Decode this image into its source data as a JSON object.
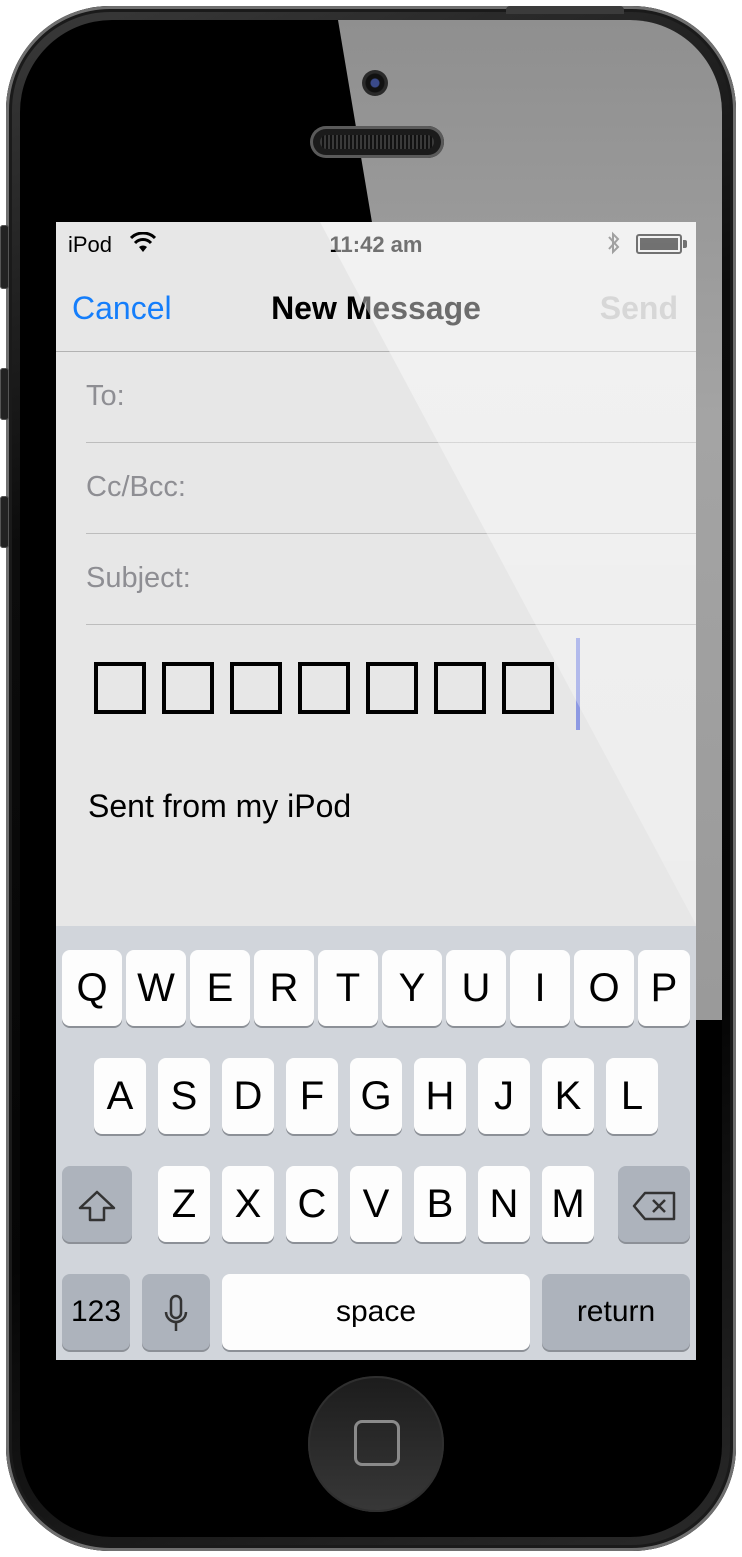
{
  "status_bar": {
    "carrier": "iPod",
    "time": "11:42 am"
  },
  "nav": {
    "cancel": "Cancel",
    "title": "New Message",
    "send": "Send"
  },
  "fields": {
    "to": "To:",
    "cc": "Cc/Bcc:",
    "subject": "Subject:"
  },
  "body": {
    "signature": "Sent from my iPod"
  },
  "keyboard": {
    "row1": [
      "Q",
      "W",
      "E",
      "R",
      "T",
      "Y",
      "U",
      "I",
      "O",
      "P"
    ],
    "row2": [
      "A",
      "S",
      "D",
      "F",
      "G",
      "H",
      "J",
      "K",
      "L"
    ],
    "row3": [
      "Z",
      "X",
      "C",
      "V",
      "B",
      "N",
      "M"
    ],
    "numbers": "123",
    "space": "space",
    "return": "return"
  },
  "colors": {
    "accent": "#157efb",
    "disabled": "#b9b9b9"
  }
}
